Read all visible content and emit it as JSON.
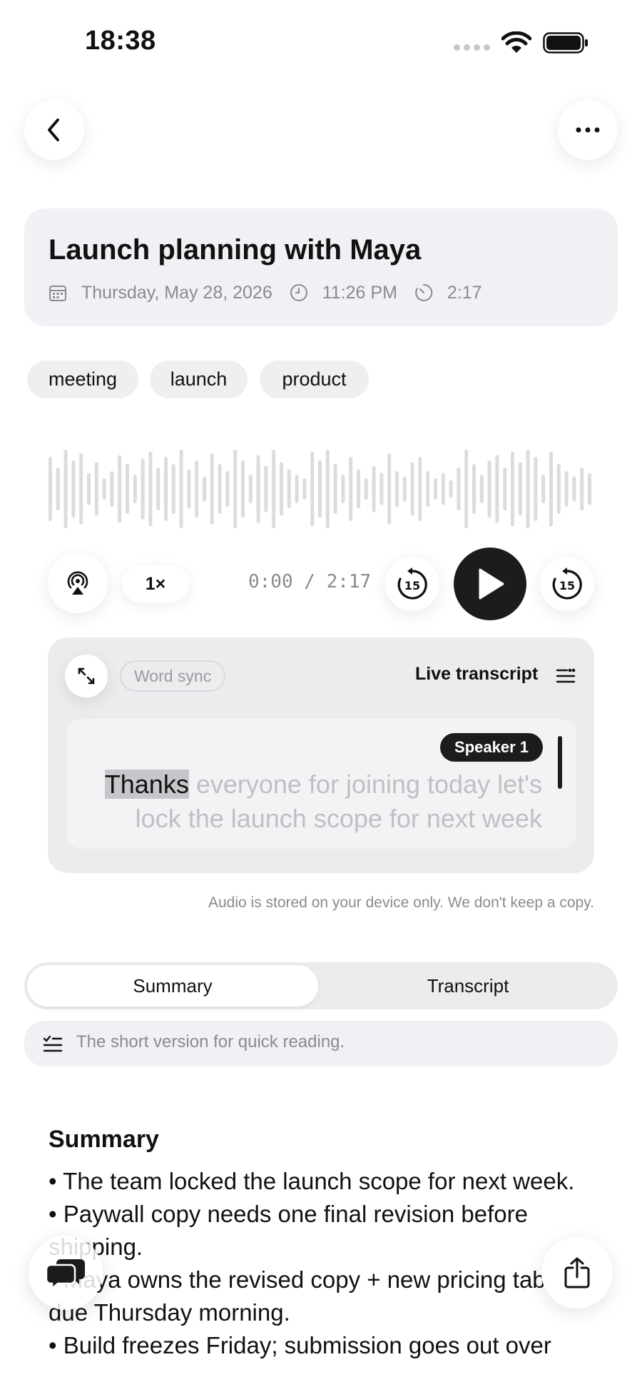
{
  "status_bar": {
    "time": "18:38"
  },
  "header": {
    "back_icon": "chevron-left-icon",
    "more_icon": "ellipsis-icon"
  },
  "recording": {
    "title": "Launch planning with Maya",
    "date": "Thursday, May 28, 2026",
    "time": "11:26 PM",
    "duration": "2:17"
  },
  "tags": [
    "meeting",
    "launch",
    "product"
  ],
  "player": {
    "speed": "1×",
    "time_readout": "0:00 / 2:17",
    "skip_back_label": "15",
    "skip_forward_label": "15",
    "progress": 0
  },
  "transcript_panel": {
    "word_sync_label": "Word sync",
    "live_label": "Live transcript",
    "speaker": "Speaker 1",
    "highlighted_word": "Thanks",
    "line1_rest": " everyone for joining today let's",
    "line2": "lock the launch scope for next week"
  },
  "privacy_note": "Audio is stored on your device only. We don't keep a copy.",
  "tabs": [
    {
      "label": "Summary",
      "active": true
    },
    {
      "label": "Transcript",
      "active": false
    }
  ],
  "hint": "The short version for quick reading.",
  "summary": {
    "heading": "Summary",
    "bullets": [
      "• The team locked the launch scope for next week.",
      "• Paywall copy needs one final revision before shipping.",
      "• Maya owns the revised copy + new pricing table, due Thursday morning.",
      "• Build freezes Friday; submission goes out over"
    ]
  },
  "colors": {
    "accent": "#1c1c1e",
    "muted": "#8a8a8f",
    "card": "#f1f1f5"
  }
}
